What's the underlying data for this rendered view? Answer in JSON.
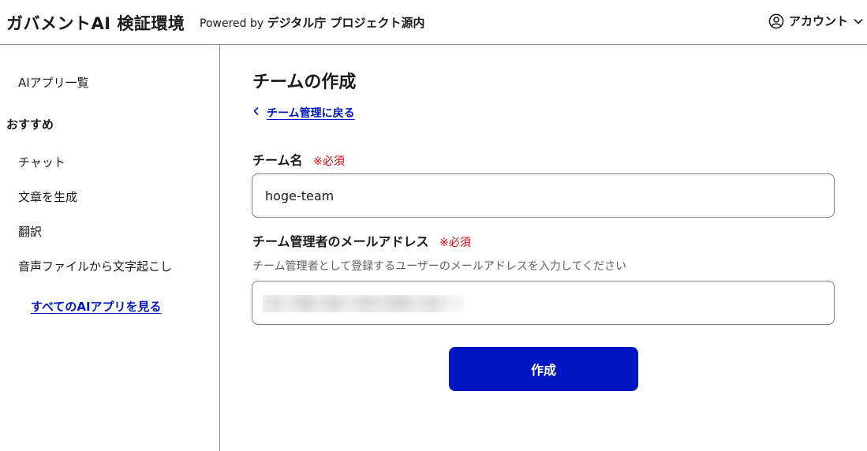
{
  "header": {
    "app_title": "ガバメントAI 検証環境",
    "powered_by": "Powered by",
    "organization": "デジタル庁 プロジェクト源内",
    "account_label": "アカウント",
    "account_icon": "user-circle-icon",
    "chevron_icon": "chevron-down-icon"
  },
  "sidebar": {
    "app_list": "AIアプリ一覧",
    "section_heading": "おすすめ",
    "items": [
      {
        "label": "チャット"
      },
      {
        "label": "文章を生成"
      },
      {
        "label": "翻訳"
      },
      {
        "label": "音声ファイルから文字起こし"
      }
    ],
    "see_all": "すべてのAIアプリを見る"
  },
  "main": {
    "page_title": "チームの作成",
    "back_link": "チーム管理に戻る",
    "back_icon": "chevron-left-icon",
    "team_name": {
      "label": "チーム名",
      "required": "※必須",
      "value": "hoge-team"
    },
    "admin_email": {
      "label": "チーム管理者のメールアドレス",
      "required": "※必須",
      "hint": "チーム管理者として登録するユーザーのメールアドレスを入力してください",
      "value": ""
    },
    "submit_label": "作成"
  },
  "colors": {
    "accent": "#0017c1",
    "required": "#e60012",
    "border": "#8f8f8f"
  }
}
